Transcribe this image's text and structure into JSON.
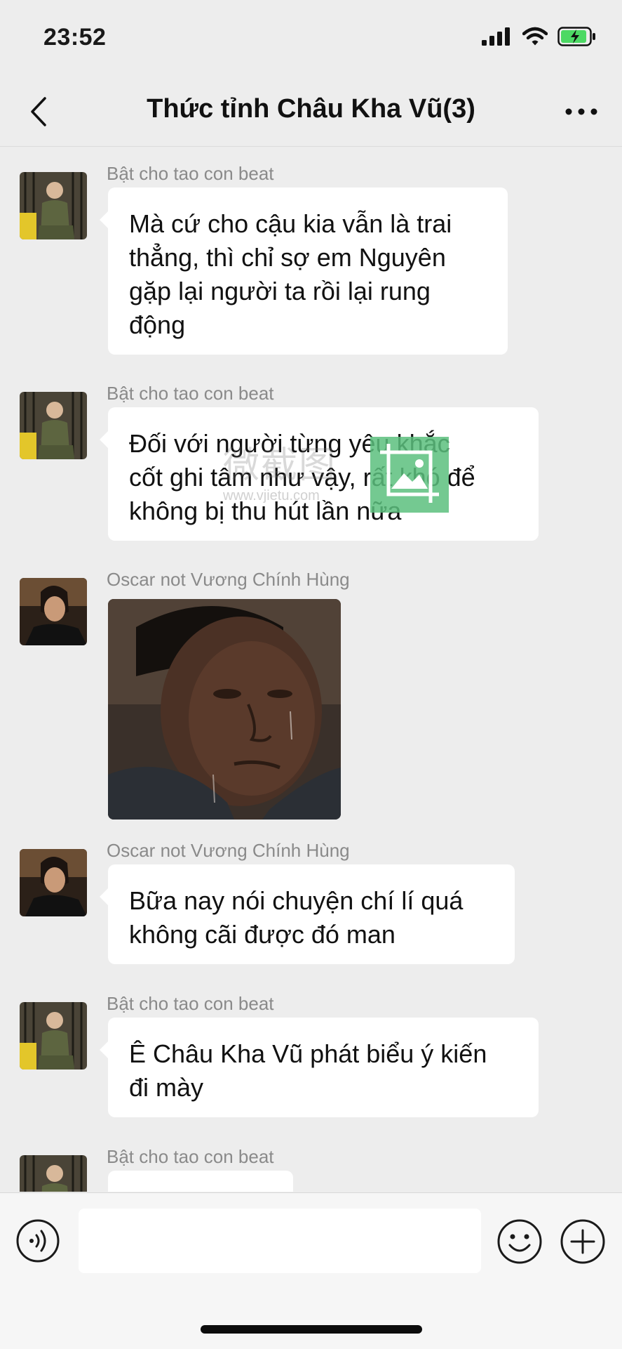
{
  "status_bar": {
    "time": "23:52",
    "battery_color": "#4cd964"
  },
  "header": {
    "title": "Thức tỉnh Châu Kha Vũ(3)"
  },
  "messages": [
    {
      "sender": "Bật cho tao con beat",
      "lines": [
        "Mà cứ cho cậu kia vẫn là trai",
        "thẳng, thì chỉ sợ em Nguyên",
        "gặp lại người ta rồi lại rung",
        "động"
      ]
    },
    {
      "sender": "Bật cho tao con beat",
      "lines": [
        "Đối với người từng yêu khắc",
        "cốt ghi tâm như vậy, rất khó để",
        "không bị thu hút lần nữa"
      ]
    },
    {
      "sender": "Oscar not Vương Chính Hùng",
      "type": "image"
    },
    {
      "sender": "Oscar not Vương Chính Hùng",
      "lines": [
        "Bữa nay nói chuyện chí lí quá",
        "không cãi được đó man"
      ]
    },
    {
      "sender": "Bật cho tao con beat",
      "lines": [
        "Ê Châu Kha Vũ phát biểu ý kiến",
        "đi mày"
      ]
    },
    {
      "sender": "Bật cho tao con beat"
    }
  ],
  "watermark": {
    "text_cn": "微截图",
    "url": "www.vjietu.com",
    "color": "#5cbf7e"
  },
  "input": {
    "placeholder": ""
  }
}
